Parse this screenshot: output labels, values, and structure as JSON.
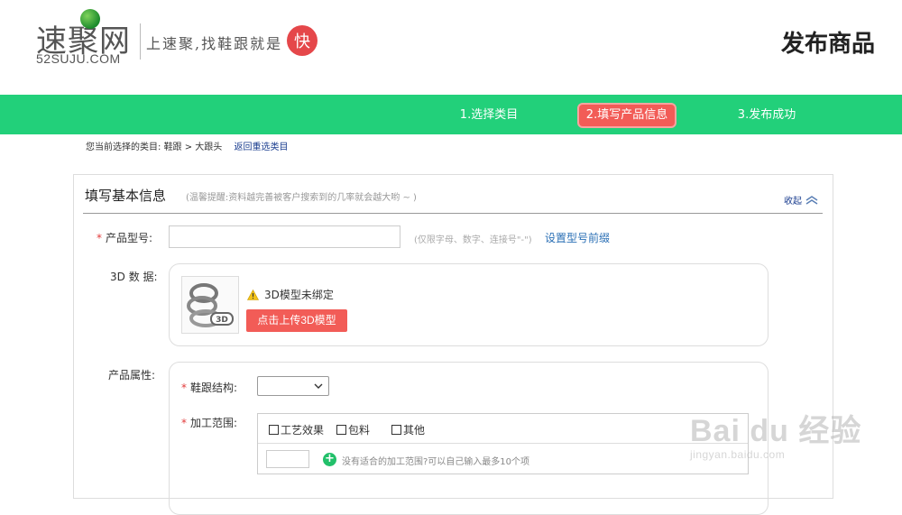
{
  "header": {
    "logo_cn": "速聚网",
    "logo_en": "52SUJU.COM",
    "slogan": "上速聚,找鞋跟就是",
    "slogan_badge": "快",
    "page_title": "发布商品"
  },
  "steps": [
    {
      "label": "1.选择类目",
      "active": false
    },
    {
      "label": "2.填写产品信息",
      "active": true
    },
    {
      "label": "3.发布成功",
      "active": false
    }
  ],
  "breadcrumb": {
    "prefix": "您当前选择的类目:",
    "path": "鞋跟 > 大跟头",
    "back_link": "返回重选类目"
  },
  "panel": {
    "title": "填写基本信息",
    "tip": "(温馨提醒:资料越完善被客户搜索到的几率就会越大哟 ~ )",
    "collapse_label": "收起",
    "model_no": {
      "required_mark": "*",
      "label": "产品型号:",
      "value": "",
      "hint": "(仅限字母、数字、连接号\"-\")",
      "link": "设置型号前缀"
    },
    "data3d": {
      "label": "3D 数 据:",
      "status": "3D模型未绑定",
      "upload_button": "点击上传3D模型"
    },
    "attributes": {
      "label": "产品属性:",
      "structure": {
        "required_mark": "*",
        "label": "鞋跟结构:",
        "value": ""
      },
      "range": {
        "required_mark": "*",
        "label": "加工范围:",
        "options": [
          "工艺效果",
          "包料",
          "其他"
        ],
        "custom_value": "",
        "hint": "没有适合的加工范围?可以自己输入最多10个项"
      }
    }
  },
  "watermark": {
    "main": "Bai du 经验",
    "sub": "jingyan.baidu.com"
  },
  "colors": {
    "green": "#22d07a",
    "red": "#f25c57",
    "link": "#1a3d8f"
  }
}
